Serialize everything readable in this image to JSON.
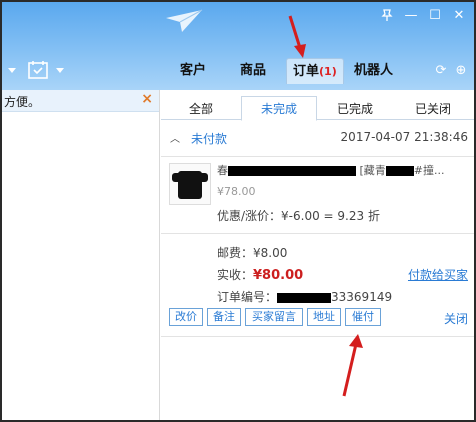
{
  "window": {
    "pin_icon": "pin-icon",
    "minimize": "—",
    "maximize": "☐",
    "close": "✕"
  },
  "nav": {
    "tabs": [
      {
        "label": "客户"
      },
      {
        "label": "商品"
      },
      {
        "label": "订单",
        "badge": "(1)"
      },
      {
        "label": "机器人"
      }
    ],
    "refresh_icon": "⟳",
    "add_icon": "⊕"
  },
  "left_panel": {
    "text": "方便。",
    "close": "×"
  },
  "order_tabs": [
    "全部",
    "未完成",
    "已完成",
    "已关闭"
  ],
  "order": {
    "status": "未付款",
    "time": "2017-04-07 21:38:46",
    "title_start": "春",
    "title_mid": "[藏青",
    "title_end": "#撞...",
    "price": "¥78.00",
    "discount": "优惠/涨价：¥-6.00 = 9.23 折",
    "postage": "邮费：¥8.00",
    "received_label": "实收：",
    "received_amount": "¥80.00",
    "pay_link": "付款给买家",
    "order_no_label": "订单编号：",
    "order_no_visible": "33369149"
  },
  "actions": [
    "改价",
    "备注",
    "买家留言",
    "地址",
    "催付"
  ],
  "close_label": "关闭",
  "colors": {
    "accent": "#2a7bd4",
    "price_red": "#cc1f1f",
    "header_blue": "#5aa8ee",
    "arrow_red": "#d41e1e"
  }
}
